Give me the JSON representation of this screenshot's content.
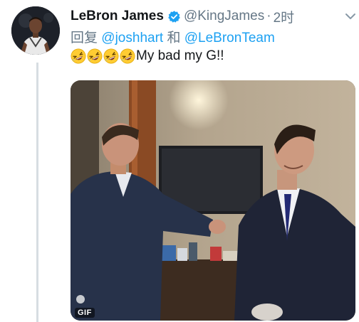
{
  "tweet": {
    "author_name": "LeBron James",
    "handle": "@KingJames",
    "separator": "·",
    "time": "2时",
    "reply_prefix": "回复",
    "mention_1": "@joshhart",
    "reply_conjunction": "和",
    "mention_2": "@LeBronTeam",
    "emoji_name": "rolling-on-the-floor-laughing",
    "emoji_count": 4,
    "text": "My bad my G!!",
    "media_badge": "GIF"
  },
  "colors": {
    "link": "#1da1f2",
    "secondary_text": "#657786",
    "verified": "#1da1f2",
    "thread_line": "#d7dde2"
  }
}
